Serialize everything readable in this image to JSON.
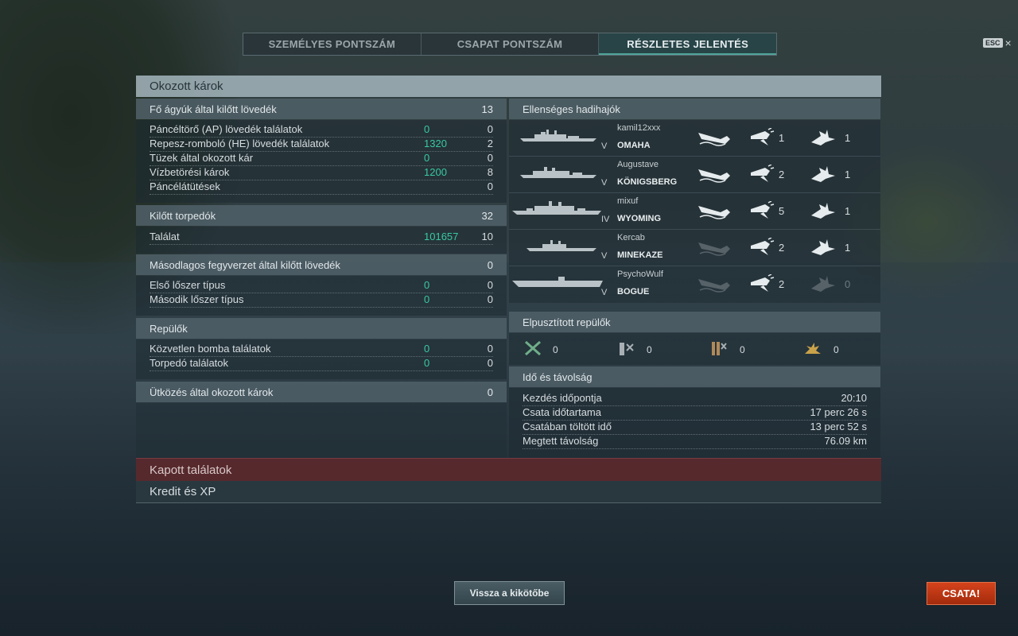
{
  "tabs": [
    {
      "label": "SZEMÉLYES PONTSZÁM",
      "active": false
    },
    {
      "label": "CSAPAT PONTSZÁM",
      "active": false
    },
    {
      "label": "RÉSZLETES JELENTÉS",
      "active": true
    }
  ],
  "esc": {
    "key": "ESC",
    "close": "×"
  },
  "damage": {
    "title": "Okozott károk",
    "main_guns": {
      "label": "Fő ágyúk által kilőtt lövedék",
      "value": "13",
      "rows": [
        {
          "label": "Páncéltörő (AP) lövedék találatok",
          "v1": "0",
          "v2": "0"
        },
        {
          "label": "Repesz-romboló (HE) lövedék találatok",
          "v1": "1320",
          "v2": "2"
        },
        {
          "label": "Tüzek által okozott kár",
          "v1": "0",
          "v2": "0"
        },
        {
          "label": "Vízbetörési károk",
          "v1": "1200",
          "v2": "8"
        },
        {
          "label": "Páncélátütések",
          "v1": "",
          "v2": "0"
        }
      ]
    },
    "torpedoes": {
      "label": "Kilőtt torpedók",
      "value": "32",
      "rows": [
        {
          "label": "Találat",
          "v1": "101657",
          "v2": "10"
        }
      ]
    },
    "secondary": {
      "label": "Másodlagos fegyverzet által kilőtt lövedék",
      "value": "0",
      "rows": [
        {
          "label": "Első lőszer típus",
          "v1": "0",
          "v2": "0"
        },
        {
          "label": "Második lőszer típus",
          "v1": "0",
          "v2": "0"
        }
      ]
    },
    "aircraft": {
      "label": "Repülők",
      "value": "",
      "rows": [
        {
          "label": "Közvetlen bomba találatok",
          "v1": "0",
          "v2": "0"
        },
        {
          "label": "Torpedó találatok",
          "v1": "0",
          "v2": "0"
        }
      ]
    },
    "ramming": {
      "label": "Ütközés által okozott károk",
      "value": "0"
    }
  },
  "enemies": {
    "title": "Ellenséges hadihajók",
    "ships": [
      {
        "player": "kamil12xxx",
        "ship": "OMAHA",
        "tier": "V",
        "sunk": true,
        "hits": "1",
        "hits2": "1",
        "hits2_active": true
      },
      {
        "player": "Augustave",
        "ship": "KÖNIGSBERG",
        "tier": "V",
        "sunk": true,
        "hits": "2",
        "hits2": "1",
        "hits2_active": true
      },
      {
        "player": "mixuf",
        "ship": "WYOMING",
        "tier": "IV",
        "sunk": true,
        "hits": "5",
        "hits2": "1",
        "hits2_active": true
      },
      {
        "player": "Kercab",
        "ship": "MINEKAZE",
        "tier": "V",
        "sunk": false,
        "hits": "2",
        "hits2": "1",
        "hits2_active": true
      },
      {
        "player": "PsychoWulf",
        "ship": "BOGUE",
        "tier": "V",
        "sunk": false,
        "hits": "2",
        "hits2": "0",
        "hits2_active": false
      }
    ]
  },
  "planes": {
    "title": "Elpusztított repülők",
    "items": [
      {
        "icon": "fighter-icon",
        "value": "0"
      },
      {
        "icon": "torpedo-bomber-icon",
        "value": "0"
      },
      {
        "icon": "dive-bomber-icon",
        "value": "0"
      },
      {
        "icon": "scout-plane-icon",
        "value": "0"
      }
    ]
  },
  "time": {
    "title": "Idő és távolság",
    "rows": [
      {
        "label": "Kezdés időpontja",
        "value": "20:10"
      },
      {
        "label": "Csata időtartama",
        "value": "17 perc 26 s"
      },
      {
        "label": "Csatában töltött idő",
        "value": "13 perc 52 s"
      },
      {
        "label": "Megtett távolság",
        "value": "76.09 km"
      }
    ]
  },
  "received_label": "Kapott találatok",
  "credit_label": "Kredit és XP",
  "buttons": {
    "back_to_port": "Vissza a kikötőbe",
    "battle": "CSATA!"
  },
  "colors": {
    "accent": "#39c9a0",
    "battle": "#c2360f",
    "received": "#5f282c"
  }
}
